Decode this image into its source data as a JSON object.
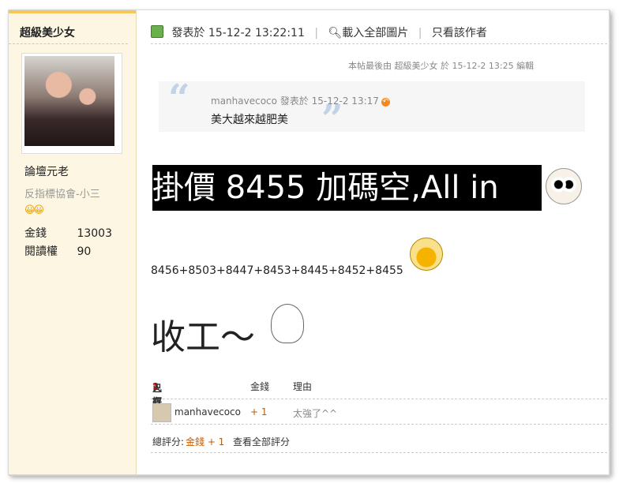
{
  "author": {
    "name": "超級美少女",
    "rank": "論壇元老",
    "group": "反指標協會-小三",
    "stats": [
      {
        "label": "金錢",
        "value": "13003"
      },
      {
        "label": "閱讀權",
        "value": "90"
      }
    ]
  },
  "post": {
    "posted_label": "發表於",
    "posted_time": "15-12-2 13:22:11",
    "load_images": "載入全部圖片",
    "only_author": "只看該作者",
    "edited_note": "本帖最後由 超級美少女 於 15-12-2 13:25 編輯",
    "quote": {
      "user": "manhavecoco",
      "posted_label": "發表於",
      "time": "15-12-2 13:17",
      "text": "美大越來越肥美"
    },
    "headline": "掛價 8455 加碼空,All in",
    "sequence": "8456+8503+8447+8453+8445+8452+8455",
    "closing": "收工～"
  },
  "rating": {
    "summary_prefix": "已有",
    "count": "1",
    "summary_suffix": "人評分",
    "col_money": "金錢",
    "col_reason": "理由",
    "rows": [
      {
        "user": "manhavecoco",
        "money": "+ 1",
        "reason": "太強了^^"
      }
    ],
    "total_label": "總評分:",
    "total_value": "金錢 + 1",
    "view_all": "查看全部評分"
  }
}
